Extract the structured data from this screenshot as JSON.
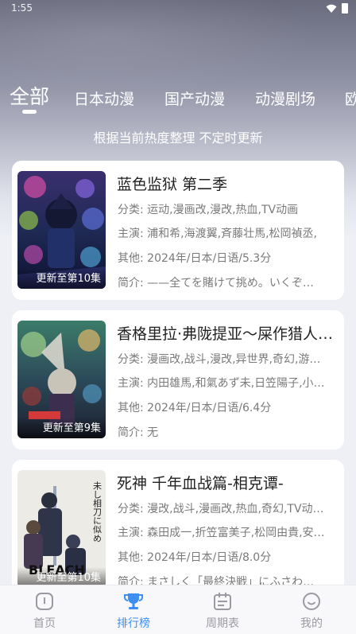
{
  "status_bar": {
    "time": "1:55"
  },
  "tabs": [
    {
      "label": "全部",
      "active": true
    },
    {
      "label": "日本动漫",
      "active": false
    },
    {
      "label": "国产动漫",
      "active": false
    },
    {
      "label": "动漫剧场",
      "active": false
    },
    {
      "label": "欧",
      "active": false
    }
  ],
  "subtitle": "根据当前热度整理 不定时更新",
  "labels": {
    "category": "分类:",
    "cast": "主演:",
    "other": "其他:",
    "intro": "简介:"
  },
  "items": [
    {
      "title": "蓝色监狱 第二季",
      "category": "运动,漫画改,漫改,热血,TV动画",
      "cast": "浦和希,海渡翼,斉藤壮馬,松岡禎丞,",
      "other": "2024年/日本/日语/5.3分",
      "intro": "——全てを賭けて挑め。いくぞ…",
      "badge": "更新至第10集"
    },
    {
      "title": "香格里拉·弗陇提亚～屎作猎人…",
      "category": "漫画改,战斗,漫改,异世界,奇幻,游…",
      "cast": "内田雄馬,和氣あず未,日笠陽子,小…",
      "other": "2024年/日本/日语/6.4分",
      "intro": "无",
      "badge": "更新至第9集"
    },
    {
      "title": "死神 千年血战篇-相克谭-",
      "category": "漫改,战斗,漫画改,热血,奇幻,TV动…",
      "cast": "森田成一,折笠富美子,松岡由貴,安…",
      "other": "2024年/日本/日语/8.0分",
      "intro": "まさしく「最終決戦」にふさわ…",
      "badge": "更新至第10集",
      "poster_text": {
        "logo": "BLEACH",
        "tagline": "未し相刀に似め"
      }
    }
  ],
  "bottom_nav": [
    {
      "label": "首页",
      "icon": "home-icon",
      "active": false
    },
    {
      "label": "排行榜",
      "icon": "trophy-icon",
      "active": true
    },
    {
      "label": "周期表",
      "icon": "calendar-icon",
      "active": false
    },
    {
      "label": "我的",
      "icon": "profile-icon",
      "active": false
    }
  ],
  "colors": {
    "accent": "#3d8ef0",
    "inactive": "#9a9aa2",
    "card_bg": "#ffffff",
    "page_bg": "#eef0f6"
  }
}
